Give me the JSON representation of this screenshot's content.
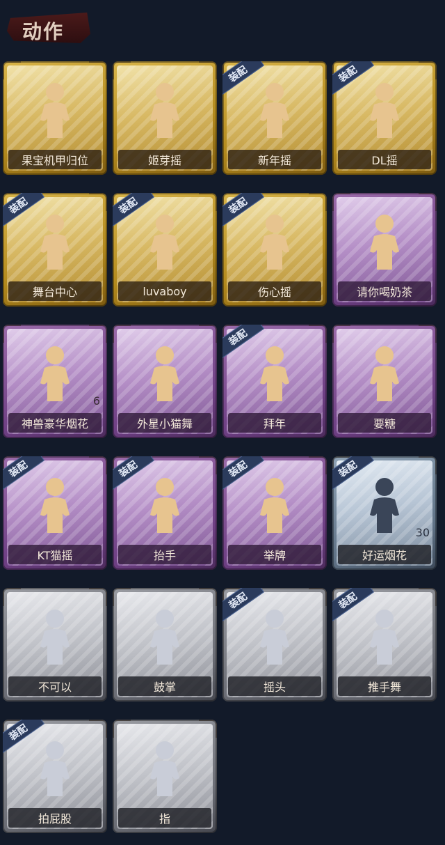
{
  "header": {
    "title": "动作"
  },
  "equip_tag": "装配",
  "colors": {
    "gold": "#d9b54a",
    "purple": "#9c6cab",
    "bluegray": "#90a4b7",
    "gray": "#9a9ca2",
    "equip_badge": "#2b3b5c",
    "background": "#121a29"
  },
  "cards": [
    {
      "label": "果宝机甲归位",
      "rarity": "gold",
      "equipped": false,
      "count": "",
      "icon": "figure-dance-icon"
    },
    {
      "label": "姬芽摇",
      "rarity": "gold",
      "equipped": false,
      "count": "",
      "icon": "figure-wave-icon"
    },
    {
      "label": "新年摇",
      "rarity": "gold",
      "equipped": true,
      "count": "",
      "icon": "figure-clap-icon"
    },
    {
      "label": "DL摇",
      "rarity": "gold",
      "equipped": true,
      "count": "",
      "icon": "figure-raise-arm-icon"
    },
    {
      "label": "舞台中心",
      "rarity": "gold",
      "equipped": true,
      "count": "",
      "icon": "figure-pose-icon"
    },
    {
      "label": "luvaboy",
      "rarity": "gold",
      "equipped": true,
      "count": "",
      "icon": "figure-cross-arms-icon"
    },
    {
      "label": "伤心摇",
      "rarity": "gold",
      "equipped": true,
      "count": "",
      "icon": "figure-heart-hands-icon"
    },
    {
      "label": "请你喝奶茶",
      "rarity": "purple",
      "equipped": false,
      "count": "",
      "icon": "figure-sign-icon"
    },
    {
      "label": "神兽豪华烟花",
      "rarity": "purple",
      "equipped": false,
      "count": "6",
      "icon": "fireworks-pot-icon"
    },
    {
      "label": "外星小猫舞",
      "rarity": "purple",
      "equipped": false,
      "count": "",
      "icon": "figure-cat-dance-icon"
    },
    {
      "label": "拜年",
      "rarity": "purple",
      "equipped": true,
      "count": "",
      "icon": "figure-bow-icon"
    },
    {
      "label": "要糖",
      "rarity": "purple",
      "equipped": false,
      "count": "",
      "icon": "figure-reach-icon"
    },
    {
      "label": "KT猫摇",
      "rarity": "purple",
      "equipped": true,
      "count": "",
      "icon": "figure-music-icon"
    },
    {
      "label": "抬手",
      "rarity": "purple",
      "equipped": true,
      "count": "",
      "icon": "figure-raise-hand-icon"
    },
    {
      "label": "举牌",
      "rarity": "purple",
      "equipped": true,
      "count": "",
      "icon": "figure-placard-icon"
    },
    {
      "label": "好运烟花",
      "rarity": "bluegray",
      "equipped": true,
      "count": "30",
      "icon": "firework-can-icon"
    },
    {
      "label": "不可以",
      "rarity": "gray",
      "equipped": false,
      "count": "",
      "icon": "finger-no-icon"
    },
    {
      "label": "鼓掌",
      "rarity": "gray",
      "equipped": false,
      "count": "",
      "icon": "clap-hands-icon"
    },
    {
      "label": "摇头",
      "rarity": "gray",
      "equipped": true,
      "count": "",
      "icon": "figure-shake-head-icon"
    },
    {
      "label": "推手舞",
      "rarity": "gray",
      "equipped": true,
      "count": "",
      "icon": "figure-push-hands-icon"
    },
    {
      "label": "拍屁股",
      "rarity": "gray",
      "equipped": true,
      "count": "",
      "icon": "figure-slap-icon"
    },
    {
      "label": "指",
      "rarity": "gray",
      "equipped": false,
      "count": "",
      "icon": "pointing-hand-icon"
    }
  ]
}
